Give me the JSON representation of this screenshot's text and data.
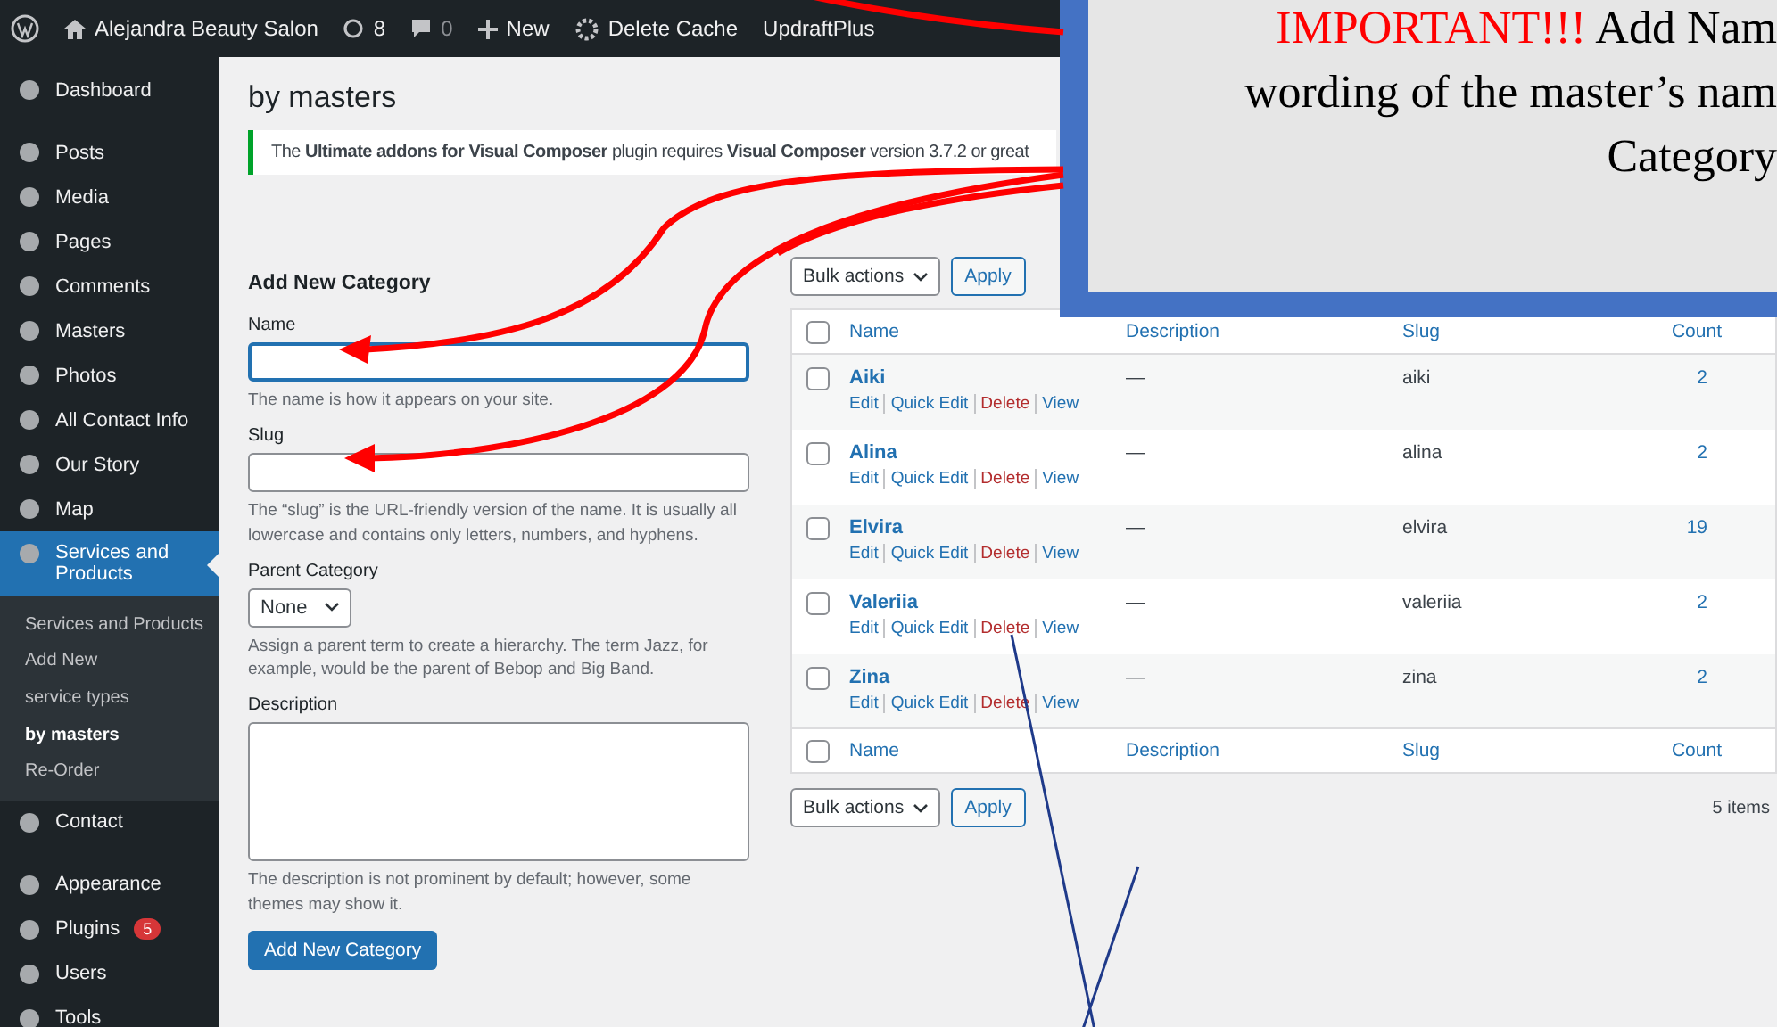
{
  "admin_bar": {
    "site": "Alejandra Beauty Salon",
    "updates": "8",
    "comments": "0",
    "new": "New",
    "cache": "Delete Cache",
    "plugin": "UpdraftPlus"
  },
  "sidebar": {
    "groups": [
      {
        "items": [
          {
            "label": "Dashboard",
            "selected": false
          }
        ]
      },
      {
        "items": [
          {
            "label": "Posts",
            "selected": false
          },
          {
            "label": "Media",
            "selected": false
          },
          {
            "label": "Pages",
            "selected": false
          },
          {
            "label": "Comments",
            "selected": false
          },
          {
            "label": "Masters",
            "selected": false
          },
          {
            "label": "Photos",
            "selected": false
          },
          {
            "label": "All Contact Info",
            "selected": false
          },
          {
            "label": "Our Story",
            "selected": false
          },
          {
            "label": "Map",
            "selected": false
          },
          {
            "label": "Services and Products",
            "selected": true,
            "children": [
              {
                "label": "Services and Products",
                "selected": false
              },
              {
                "label": "Add New",
                "selected": false
              },
              {
                "label": "service types",
                "selected": false
              },
              {
                "label": "by masters",
                "selected": true
              },
              {
                "label": "Re-Order",
                "selected": false
              }
            ]
          },
          {
            "label": "Contact",
            "selected": false
          }
        ]
      },
      {
        "items": [
          {
            "label": "Appearance",
            "selected": false
          },
          {
            "label": "Plugins",
            "selected": false,
            "badge": "5"
          },
          {
            "label": "Users",
            "selected": false
          },
          {
            "label": "Tools",
            "selected": false
          }
        ]
      }
    ]
  },
  "page_title": "by masters",
  "notice": "The **Ultimate addons for Visual Composer** plugin requires **Visual Composer** version 3.7.2 or great",
  "form": {
    "heading": "Add New Category",
    "name": {
      "label": "Name",
      "help": "The name is how it appears on your site."
    },
    "slug": {
      "label": "Slug",
      "help": "The “slug” is the URL-friendly version of the name. It is usually all lowercase and contains only letters, numbers, and hyphens."
    },
    "parent": {
      "label": "Parent Category",
      "value": "None",
      "help": "Assign a parent term to create a hierarchy. The term Jazz, for example, would be the parent of Bebop and Big Band."
    },
    "description": {
      "label": "Description",
      "help": "The description is not prominent by default; however, some themes may show it."
    },
    "submit": "Add New Category"
  },
  "table": {
    "bulk_top": {
      "select": "Bulk actions",
      "apply": "Apply"
    },
    "select_all_checked": false,
    "columns": [
      "Name",
      "Description",
      "Slug",
      "Count"
    ],
    "rows": [
      {
        "name": "Aiki",
        "actions": [
          "Edit",
          "Quick Edit",
          "Delete",
          "View"
        ],
        "description": "—",
        "slug": "aiki",
        "count": "2",
        "checked": false
      },
      {
        "name": "Alina",
        "actions": [
          "Edit",
          "Quick Edit",
          "Delete",
          "View"
        ],
        "description": "—",
        "slug": "alina",
        "count": "2",
        "checked": false
      },
      {
        "name": "Elvira",
        "actions": [
          "Edit",
          "Quick Edit",
          "Delete",
          "View"
        ],
        "description": "—",
        "slug": "elvira",
        "count": "19",
        "checked": false
      },
      {
        "name": "Valeriia",
        "actions": [
          "Edit",
          "Quick Edit",
          "Delete",
          "View"
        ],
        "description": "—",
        "slug": "valeriia",
        "count": "2",
        "checked": false
      },
      {
        "name": "Zina",
        "actions": [
          "Edit",
          "Quick Edit",
          "Delete",
          "View"
        ],
        "description": "—",
        "slug": "zina",
        "count": "2",
        "checked": false
      }
    ],
    "footer_select_all_checked": false,
    "footer_columns": [
      "Name",
      "Description",
      "Slug",
      "Count"
    ],
    "bulk_bottom": {
      "select": "Bulk actions",
      "apply": "Apply"
    },
    "item_count": "5 items"
  },
  "callout": {
    "alert": "IMPORTANT!!!",
    "lines": [
      "Add Nam",
      "wording of the master’s nam",
      "Category"
    ]
  }
}
